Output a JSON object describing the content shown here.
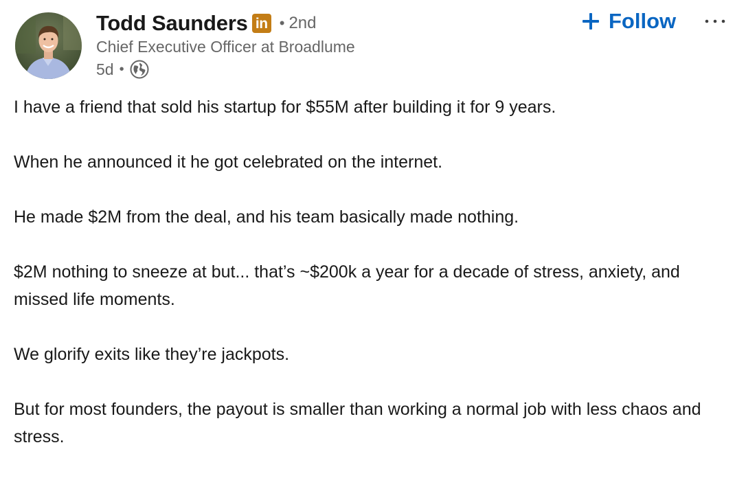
{
  "author": {
    "name": "Todd Saunders",
    "badge": "in",
    "degree": "2nd",
    "headline": "Chief Executive Officer at Broadlume",
    "time": "5d",
    "visibility_icon": "globe-icon",
    "avatar_icon": "avatar"
  },
  "actions": {
    "follow_label": "Follow",
    "follow_icon": "plus-icon",
    "more_icon": "more-icon",
    "follow_color": "#0a66c2",
    "badge_color": "#c37d16"
  },
  "post": {
    "paragraphs": [
      "I have a friend that sold his startup for $55M after building it for 9 years.",
      "When he announced it he got celebrated on the internet.",
      "He made $2M from the deal, and his team basically made nothing.",
      "$2M nothing to sneeze at but... that’s ~$200k a year for a decade of stress, anxiety, and missed life moments.",
      "We glorify exits like they’re jackpots.",
      "But for most founders, the payout is smaller than working a normal job with less chaos and stress."
    ]
  }
}
